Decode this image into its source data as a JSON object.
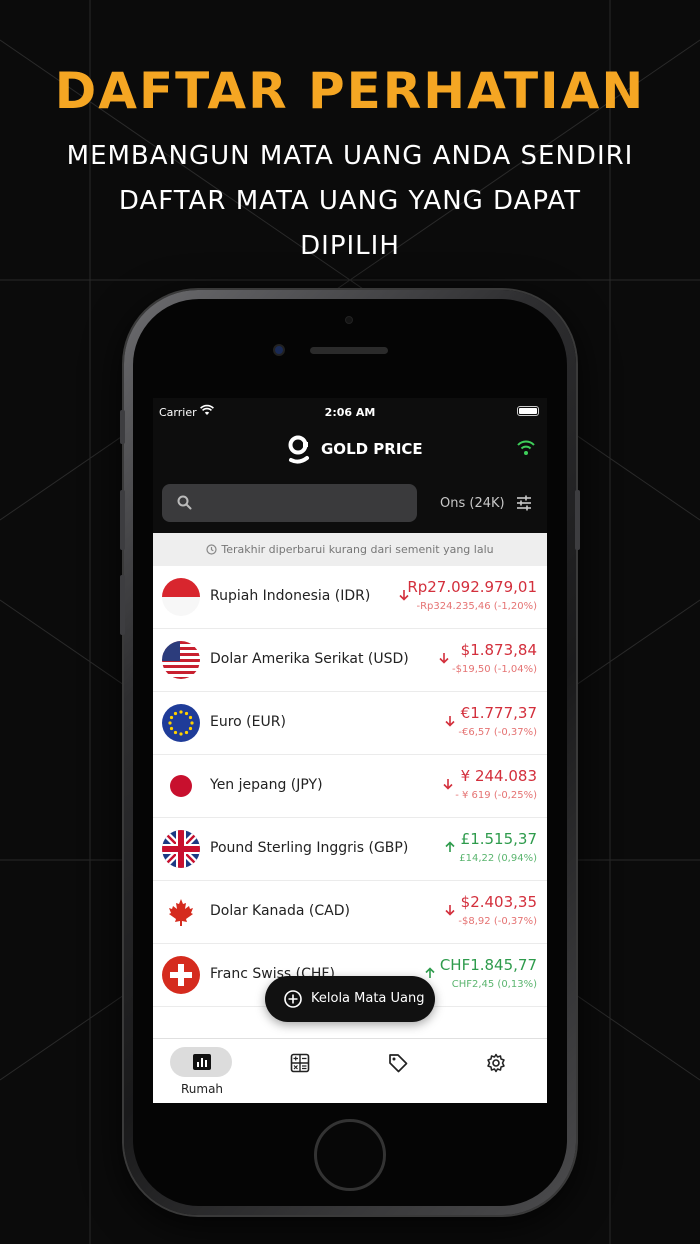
{
  "promo": {
    "headline": "DAFTAR PERHATIAN",
    "subline_1": "MEMBANGUN MATA UANG ANDA SENDIRI",
    "subline_2": "DAFTAR MATA UANG YANG DAPAT",
    "subline_3": "DIPILIH"
  },
  "status_bar": {
    "carrier": "Carrier",
    "time": "2:06 AM"
  },
  "header": {
    "title": "GOLD PRICE",
    "logo_icon": "g-logo-icon",
    "signal_icon": "wifi-icon"
  },
  "search": {
    "placeholder": "",
    "value": ""
  },
  "unit": {
    "label": "Ons (24K)",
    "icon": "sliders-icon"
  },
  "updated_text": "Terakhir diperbarui kurang dari semenit yang lalu",
  "currencies": [
    {
      "name": "Rupiah Indonesia (IDR)",
      "price": "Rp27.092.979,01",
      "change": "-Rp324.235,46 (-1,20%)",
      "direction": "down"
    },
    {
      "name": "Dolar Amerika Serikat (USD)",
      "price": "$1.873,84",
      "change": "-$19,50 (-1,04%)",
      "direction": "down"
    },
    {
      "name": "Euro (EUR)",
      "price": "€1.777,37",
      "change": "-€6,57 (-0,37%)",
      "direction": "down"
    },
    {
      "name": "Yen jepang (JPY)",
      "price": "¥ 244.083",
      "change": "- ¥ 619 (-0,25%)",
      "direction": "down"
    },
    {
      "name": "Pound Sterling Inggris (GBP)",
      "price": "£1.515,37",
      "change": "£14,22 (0,94%)",
      "direction": "up"
    },
    {
      "name": "Dolar Kanada (CAD)",
      "price": "$2.403,35",
      "change": "-$8,92 (-0,37%)",
      "direction": "down"
    },
    {
      "name": "Franc Swiss (CHF)",
      "price": "CHF1.845,77",
      "change": "CHF2,45 (0,13%)",
      "direction": "up"
    }
  ],
  "manage_button": {
    "label": "Kelola Mata Uang"
  },
  "tabs": [
    {
      "label": "Rumah",
      "icon": "chart-icon",
      "active": true
    },
    {
      "label": "",
      "icon": "calculator-icon",
      "active": false
    },
    {
      "label": "",
      "icon": "tag-icon",
      "active": false
    },
    {
      "label": "",
      "icon": "gear-icon",
      "active": false
    }
  ],
  "colors": {
    "accent": "#f5a623",
    "down": "#d32f3c",
    "up": "#2e9b4c"
  }
}
